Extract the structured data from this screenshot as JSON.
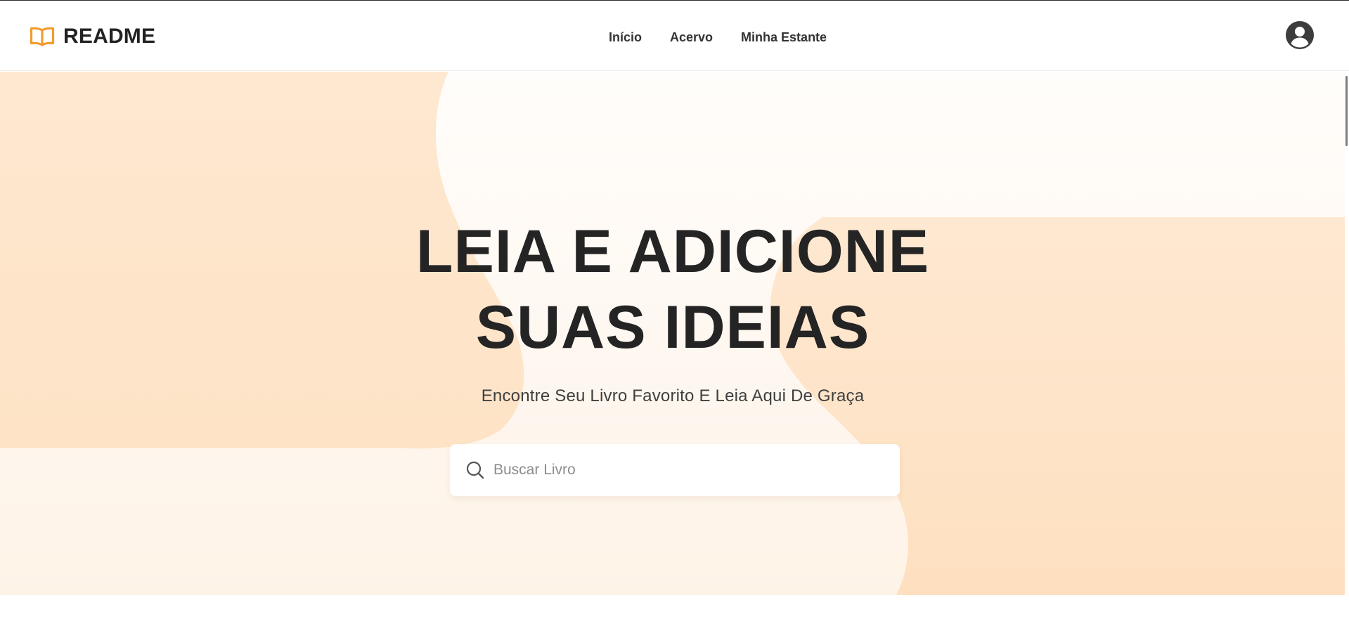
{
  "header": {
    "brand": {
      "name": "README",
      "icon": "open-book-icon"
    },
    "nav": [
      {
        "label": "Início"
      },
      {
        "label": "Acervo"
      },
      {
        "label": "Minha Estante"
      }
    ],
    "profile_icon": "user-circle-icon"
  },
  "hero": {
    "title_line_1": "LEIA E ADICIONE",
    "title_line_2": "SUAS IDEIAS",
    "subtitle": "Encontre Seu Livro Favorito E Leia Aqui De Graça",
    "search": {
      "placeholder": "Buscar Livro",
      "value": "",
      "icon": "search-icon"
    }
  },
  "colors": {
    "accent": "#F39C2D",
    "peach_dark": "#FEE5C8",
    "peach_light": "#FEF6EE",
    "text_dark": "#242424"
  }
}
